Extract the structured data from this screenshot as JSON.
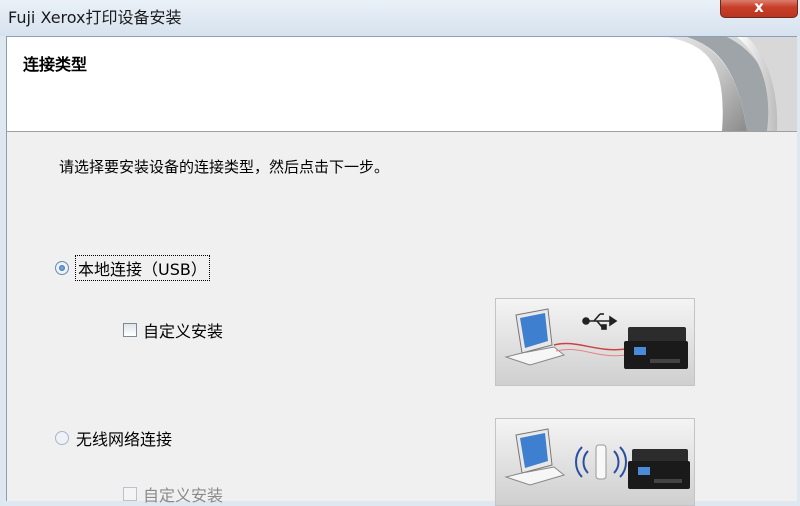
{
  "window": {
    "title": "Fuji Xerox打印设备安装",
    "close_glyph": "x"
  },
  "header": {
    "title": "连接类型"
  },
  "instruction": "请选择要安装设备的连接类型，然后点击下一步。",
  "options": [
    {
      "label": "本地连接（USB）",
      "selected": true,
      "sub_checkbox": {
        "label": "自定义安装",
        "checked": false,
        "enabled": true
      },
      "illustration": "laptop-usb-printer"
    },
    {
      "label": "无线网络连接",
      "selected": false,
      "sub_checkbox": {
        "label": "自定义安装",
        "checked": false,
        "enabled": false
      },
      "illustration": "laptop-wireless-printer"
    }
  ],
  "colors": {
    "accent": "#1d5aa3",
    "close_button": "#c8402a",
    "usb_cable": "#d04040"
  },
  "icons": [
    "close-icon",
    "page-curl-graphic",
    "usb-icon",
    "wifi-icon",
    "laptop-icon",
    "printer-icon"
  ]
}
